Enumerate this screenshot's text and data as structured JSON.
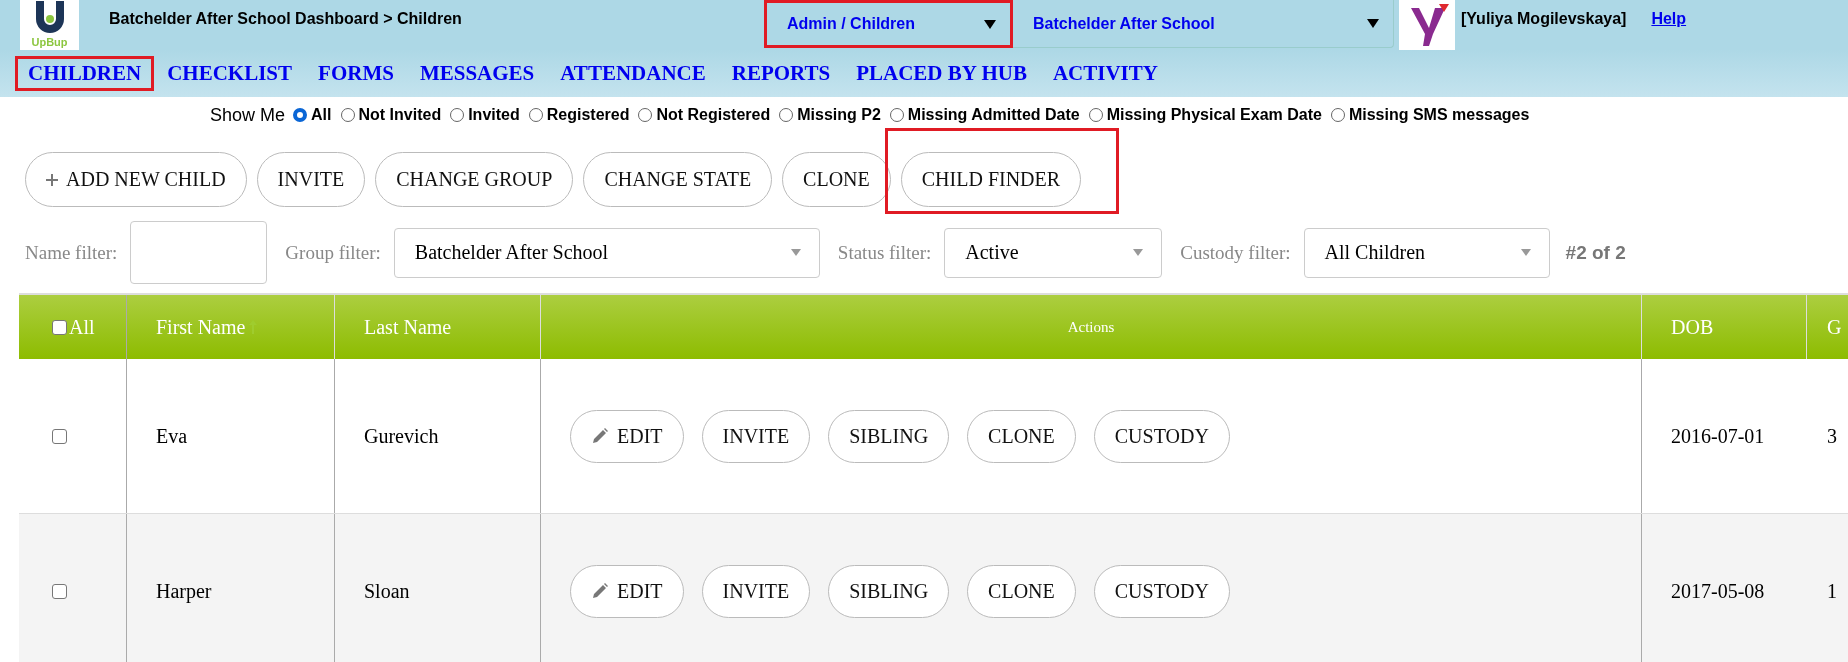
{
  "header": {
    "logo_text": "UpBup",
    "breadcrumb": "Batchelder After School Dashboard > Children",
    "dropdowns": [
      {
        "value": "Admin / Children",
        "highlighted": true
      },
      {
        "value": "Batchelder After School",
        "highlighted": false
      }
    ],
    "user": "[Yuliya Mogilevskaya]",
    "help_link": "Help"
  },
  "nav": [
    {
      "label": "CHILDREN",
      "highlighted": true
    },
    {
      "label": "CHECKLIST",
      "highlighted": false
    },
    {
      "label": "FORMS",
      "highlighted": false
    },
    {
      "label": "MESSAGES",
      "highlighted": false
    },
    {
      "label": "ATTENDANCE",
      "highlighted": false
    },
    {
      "label": "REPORTS",
      "highlighted": false
    },
    {
      "label": "PLACED BY HUB",
      "highlighted": false
    },
    {
      "label": "ACTIVITY",
      "highlighted": false
    }
  ],
  "show_me": {
    "label": "Show Me",
    "options": [
      {
        "label": "All",
        "selected": true
      },
      {
        "label": "Not Invited",
        "selected": false
      },
      {
        "label": "Invited",
        "selected": false
      },
      {
        "label": "Registered",
        "selected": false
      },
      {
        "label": "Not Registered",
        "selected": false
      },
      {
        "label": "Missing P2",
        "selected": false
      },
      {
        "label": "Missing Admitted Date",
        "selected": false
      },
      {
        "label": "Missing Physical Exam Date",
        "selected": false
      },
      {
        "label": "Missing SMS messages",
        "selected": false
      }
    ]
  },
  "toolbar": [
    {
      "label": "ADD NEW CHILD",
      "kind": "add",
      "highlighted": false
    },
    {
      "label": "INVITE",
      "kind": "plain",
      "highlighted": false
    },
    {
      "label": "CHANGE GROUP",
      "kind": "plain",
      "highlighted": false
    },
    {
      "label": "CHANGE STATE",
      "kind": "plain",
      "highlighted": false
    },
    {
      "label": "CLONE",
      "kind": "plain",
      "highlighted": false
    },
    {
      "label": "CHILD FINDER",
      "kind": "plain",
      "highlighted": true
    }
  ],
  "filters": [
    {
      "label": "Name filter:",
      "kind": "text"
    },
    {
      "label": "Group filter:",
      "kind": "select",
      "value": "Batchelder After School"
    },
    {
      "label": "Status filter:",
      "kind": "select",
      "value": "Active"
    },
    {
      "label": "Custody filter:",
      "kind": "select",
      "value": "All Children"
    }
  ],
  "count": "#2 of 2",
  "table": {
    "columns": [
      {
        "label": "All",
        "kind": "select",
        "checked": false,
        "sorted": false
      },
      {
        "label": "First Name",
        "sorted": true
      },
      {
        "label": "Last Name",
        "sorted": false
      },
      {
        "label": "Actions",
        "sorted": false
      },
      {
        "label": "DOB",
        "sorted": false
      },
      {
        "label": "G",
        "sorted": false
      }
    ],
    "rows": [
      {
        "cells": [
          {
            "kind": "checkbox",
            "checked": false
          },
          {
            "kind": "text",
            "text": "Eva"
          },
          {
            "kind": "text",
            "text": "Gurevich"
          },
          {
            "kind": "actions",
            "buttons": [
              {
                "label": "EDIT",
                "kind": "edit"
              },
              {
                "label": "INVITE",
                "kind": "plain"
              },
              {
                "label": "SIBLING",
                "kind": "plain"
              },
              {
                "label": "CLONE",
                "kind": "plain"
              },
              {
                "label": "CUSTODY",
                "kind": "plain"
              }
            ]
          },
          {
            "kind": "text",
            "text": "2016-07-01"
          },
          {
            "kind": "text",
            "text": "3"
          }
        ]
      },
      {
        "cells": [
          {
            "kind": "checkbox",
            "checked": false
          },
          {
            "kind": "text",
            "text": "Harper"
          },
          {
            "kind": "text",
            "text": "Sloan"
          },
          {
            "kind": "actions",
            "buttons": [
              {
                "label": "EDIT",
                "kind": "edit"
              },
              {
                "label": "INVITE",
                "kind": "plain"
              },
              {
                "label": "SIBLING",
                "kind": "plain"
              },
              {
                "label": "CLONE",
                "kind": "plain"
              },
              {
                "label": "CUSTODY",
                "kind": "plain"
              }
            ]
          },
          {
            "kind": "text",
            "text": "2017-05-08"
          },
          {
            "kind": "text",
            "text": "1"
          }
        ]
      }
    ]
  }
}
